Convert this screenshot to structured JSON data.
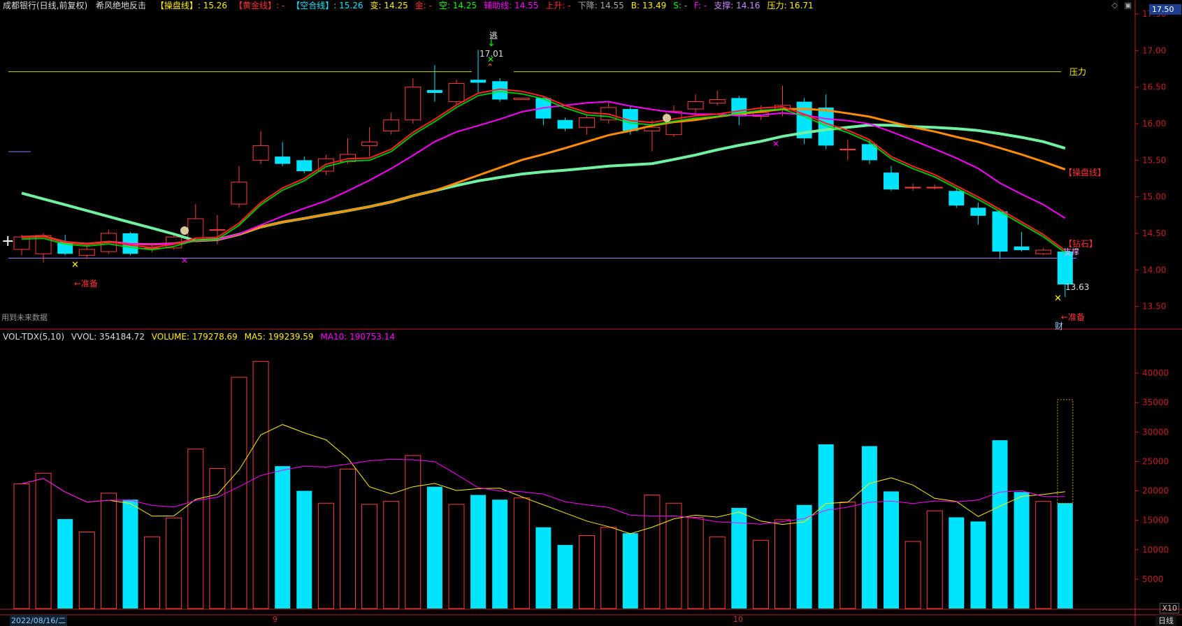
{
  "header": {
    "stock_name": "成都银行(日线,前复权)",
    "indicator_name": "希风绝地反击",
    "items": [
      {
        "label": "【操盘线】",
        "value": ": 15.26",
        "color": "#ffee00"
      },
      {
        "label": "【黄金线】",
        "value": ": -",
        "color": "#ff3030"
      },
      {
        "label": "【空合线】",
        "value": ": 15.26",
        "color": "#00e5ff"
      },
      {
        "label": "变:",
        "value": " 14.25",
        "color": "#ffee00"
      },
      {
        "label": "金:",
        "value": " -",
        "color": "#ff3030"
      },
      {
        "label": "空:",
        "value": " 14.25",
        "color": "#00ff00"
      },
      {
        "label": "辅助线:",
        "value": " 14.55",
        "color": "#ff00ff"
      },
      {
        "label": "上升:",
        "value": " -",
        "color": "#ff3030"
      },
      {
        "label": "下降:",
        "value": " 14.55",
        "color": "#aaaaaa"
      },
      {
        "label": "B:",
        "value": " 13.49",
        "color": "#ffee00"
      },
      {
        "label": "S:",
        "value": " -",
        "color": "#00ff00"
      },
      {
        "label": "F:",
        "value": " -",
        "color": "#ff00ff"
      },
      {
        "label": "支撑:",
        "value": " 14.16",
        "color": "#cc88ff"
      },
      {
        "label": "压力:",
        "value": " 16.71",
        "color": "#ffee00"
      }
    ],
    "window_icons": [
      "◇",
      "▣"
    ]
  },
  "current_price_tag": "17.50",
  "volume_header": {
    "name": "VOL-TDX(5,10)",
    "vvol": "VVOL: 354184.72",
    "volume": "VOLUME: 179278.69",
    "ma5": "MA5: 199239.59",
    "ma10": "MA10: 190753.14"
  },
  "note": "用到未来数据",
  "footer": {
    "date": "2022/08/16/二",
    "month_labels": [
      "9",
      "10"
    ],
    "period": "日线",
    "zoom": "X10"
  },
  "annotations": {
    "escape": "逃",
    "high_label": "17.01",
    "low_label": "13.63",
    "pressure": "压力",
    "control_line": "【操盘线】",
    "diamond": "【钻石】",
    "support": "支撑",
    "prepare1": "←准备",
    "prepare2": "←准备",
    "cai": "财"
  },
  "colors": {
    "up": "#ff3d3d",
    "down": "#00e5ff",
    "axis": "#c32020",
    "ma_yellow": "#ffee00",
    "ma_green": "#00e000",
    "ma_magenta": "#ff00ff"
  },
  "price_axis": {
    "min": 13.2,
    "max": 17.5,
    "ticks": [
      13.5,
      14.0,
      14.5,
      15.0,
      15.5,
      16.0,
      16.5,
      17.0,
      17.5
    ]
  },
  "volume_axis": {
    "min": 0,
    "max": 45000,
    "ticks": [
      5000,
      10000,
      15000,
      20000,
      25000,
      30000,
      35000,
      40000
    ]
  },
  "chart_data": {
    "type": "candlestick",
    "candles": [
      {
        "o": 14.28,
        "c": 14.45,
        "h": 14.48,
        "l": 14.2,
        "v": 21200
      },
      {
        "o": 14.22,
        "c": 14.47,
        "h": 14.5,
        "l": 14.1,
        "v": 23000
      },
      {
        "o": 14.38,
        "c": 14.22,
        "h": 14.48,
        "l": 14.2,
        "v": 15200
      },
      {
        "o": 14.2,
        "c": 14.28,
        "h": 14.32,
        "l": 14.15,
        "v": 13000
      },
      {
        "o": 14.25,
        "c": 14.5,
        "h": 14.55,
        "l": 14.22,
        "v": 19600
      },
      {
        "o": 14.5,
        "c": 14.22,
        "h": 14.52,
        "l": 14.2,
        "v": 18500
      },
      {
        "o": 14.3,
        "c": 14.3,
        "h": 14.36,
        "l": 14.24,
        "v": 12200
      },
      {
        "o": 14.3,
        "c": 14.45,
        "h": 14.48,
        "l": 14.28,
        "v": 15400
      },
      {
        "o": 14.4,
        "c": 14.7,
        "h": 14.9,
        "l": 14.38,
        "v": 27100
      },
      {
        "o": 14.55,
        "c": 14.55,
        "h": 14.75,
        "l": 14.35,
        "v": 23800
      },
      {
        "o": 14.9,
        "c": 15.2,
        "h": 15.42,
        "l": 14.85,
        "v": 39300
      },
      {
        "o": 15.5,
        "c": 15.7,
        "h": 15.9,
        "l": 15.45,
        "v": 42000
      },
      {
        "o": 15.55,
        "c": 15.45,
        "h": 15.75,
        "l": 15.42,
        "v": 24200
      },
      {
        "o": 15.5,
        "c": 15.35,
        "h": 15.55,
        "l": 15.32,
        "v": 20000
      },
      {
        "o": 15.35,
        "c": 15.52,
        "h": 15.57,
        "l": 15.3,
        "v": 17900
      },
      {
        "o": 15.48,
        "c": 15.58,
        "h": 15.8,
        "l": 15.45,
        "v": 23700
      },
      {
        "o": 15.7,
        "c": 15.75,
        "h": 15.95,
        "l": 15.55,
        "v": 17700
      },
      {
        "o": 15.9,
        "c": 16.05,
        "h": 16.15,
        "l": 15.85,
        "v": 18200
      },
      {
        "o": 16.05,
        "c": 16.5,
        "h": 16.62,
        "l": 16.0,
        "v": 26000
      },
      {
        "o": 16.46,
        "c": 16.42,
        "h": 16.8,
        "l": 16.3,
        "v": 20700
      },
      {
        "o": 16.3,
        "c": 16.55,
        "h": 16.6,
        "l": 16.25,
        "v": 17700
      },
      {
        "o": 16.6,
        "c": 16.56,
        "h": 17.01,
        "l": 16.42,
        "v": 19300
      },
      {
        "o": 16.58,
        "c": 16.33,
        "h": 16.62,
        "l": 16.3,
        "v": 18500
      },
      {
        "o": 16.33,
        "c": 16.35,
        "h": 16.35,
        "l": 16.35,
        "v": 18800
      },
      {
        "o": 16.35,
        "c": 16.07,
        "h": 16.38,
        "l": 15.98,
        "v": 13800
      },
      {
        "o": 16.05,
        "c": 15.93,
        "h": 16.08,
        "l": 15.9,
        "v": 10800
      },
      {
        "o": 15.95,
        "c": 16.08,
        "h": 16.12,
        "l": 15.85,
        "v": 12400
      },
      {
        "o": 16.05,
        "c": 16.22,
        "h": 16.3,
        "l": 16.0,
        "v": 13800
      },
      {
        "o": 16.2,
        "c": 15.9,
        "h": 16.25,
        "l": 15.85,
        "v": 12800
      },
      {
        "o": 15.9,
        "c": 15.95,
        "h": 16.05,
        "l": 15.62,
        "v": 19300
      },
      {
        "o": 15.85,
        "c": 16.17,
        "h": 16.25,
        "l": 15.82,
        "v": 17900
      },
      {
        "o": 16.2,
        "c": 16.3,
        "h": 16.4,
        "l": 16.1,
        "v": 15500
      },
      {
        "o": 16.28,
        "c": 16.33,
        "h": 16.45,
        "l": 16.25,
        "v": 12200
      },
      {
        "o": 16.35,
        "c": 16.12,
        "h": 16.38,
        "l": 15.98,
        "v": 17100
      },
      {
        "o": 16.1,
        "c": 16.15,
        "h": 16.25,
        "l": 16.05,
        "v": 11600
      },
      {
        "o": 16.2,
        "c": 16.25,
        "h": 16.52,
        "l": 16.1,
        "v": 15100
      },
      {
        "o": 16.3,
        "c": 15.8,
        "h": 16.35,
        "l": 15.72,
        "v": 17600
      },
      {
        "o": 16.22,
        "c": 15.7,
        "h": 16.4,
        "l": 15.65,
        "v": 27900
      },
      {
        "o": 15.65,
        "c": 15.65,
        "h": 15.78,
        "l": 15.5,
        "v": 18100
      },
      {
        "o": 15.72,
        "c": 15.5,
        "h": 15.78,
        "l": 15.45,
        "v": 27600
      },
      {
        "o": 15.33,
        "c": 15.1,
        "h": 15.42,
        "l": 15.08,
        "v": 19900
      },
      {
        "o": 15.13,
        "c": 15.13,
        "h": 15.18,
        "l": 15.08,
        "v": 11400
      },
      {
        "o": 15.13,
        "c": 15.13,
        "h": 15.17,
        "l": 15.1,
        "v": 16600
      },
      {
        "o": 15.08,
        "c": 14.88,
        "h": 15.12,
        "l": 14.85,
        "v": 15500
      },
      {
        "o": 14.85,
        "c": 14.74,
        "h": 14.92,
        "l": 14.62,
        "v": 14800
      },
      {
        "o": 14.8,
        "c": 14.25,
        "h": 14.82,
        "l": 14.15,
        "v": 28600
      },
      {
        "o": 14.32,
        "c": 14.27,
        "h": 14.52,
        "l": 14.25,
        "v": 19800
      },
      {
        "o": 14.22,
        "c": 14.27,
        "h": 14.3,
        "l": 14.2,
        "v": 18200
      },
      {
        "o": 14.25,
        "c": 13.8,
        "h": 14.3,
        "l": 13.63,
        "v": 17900
      }
    ]
  }
}
